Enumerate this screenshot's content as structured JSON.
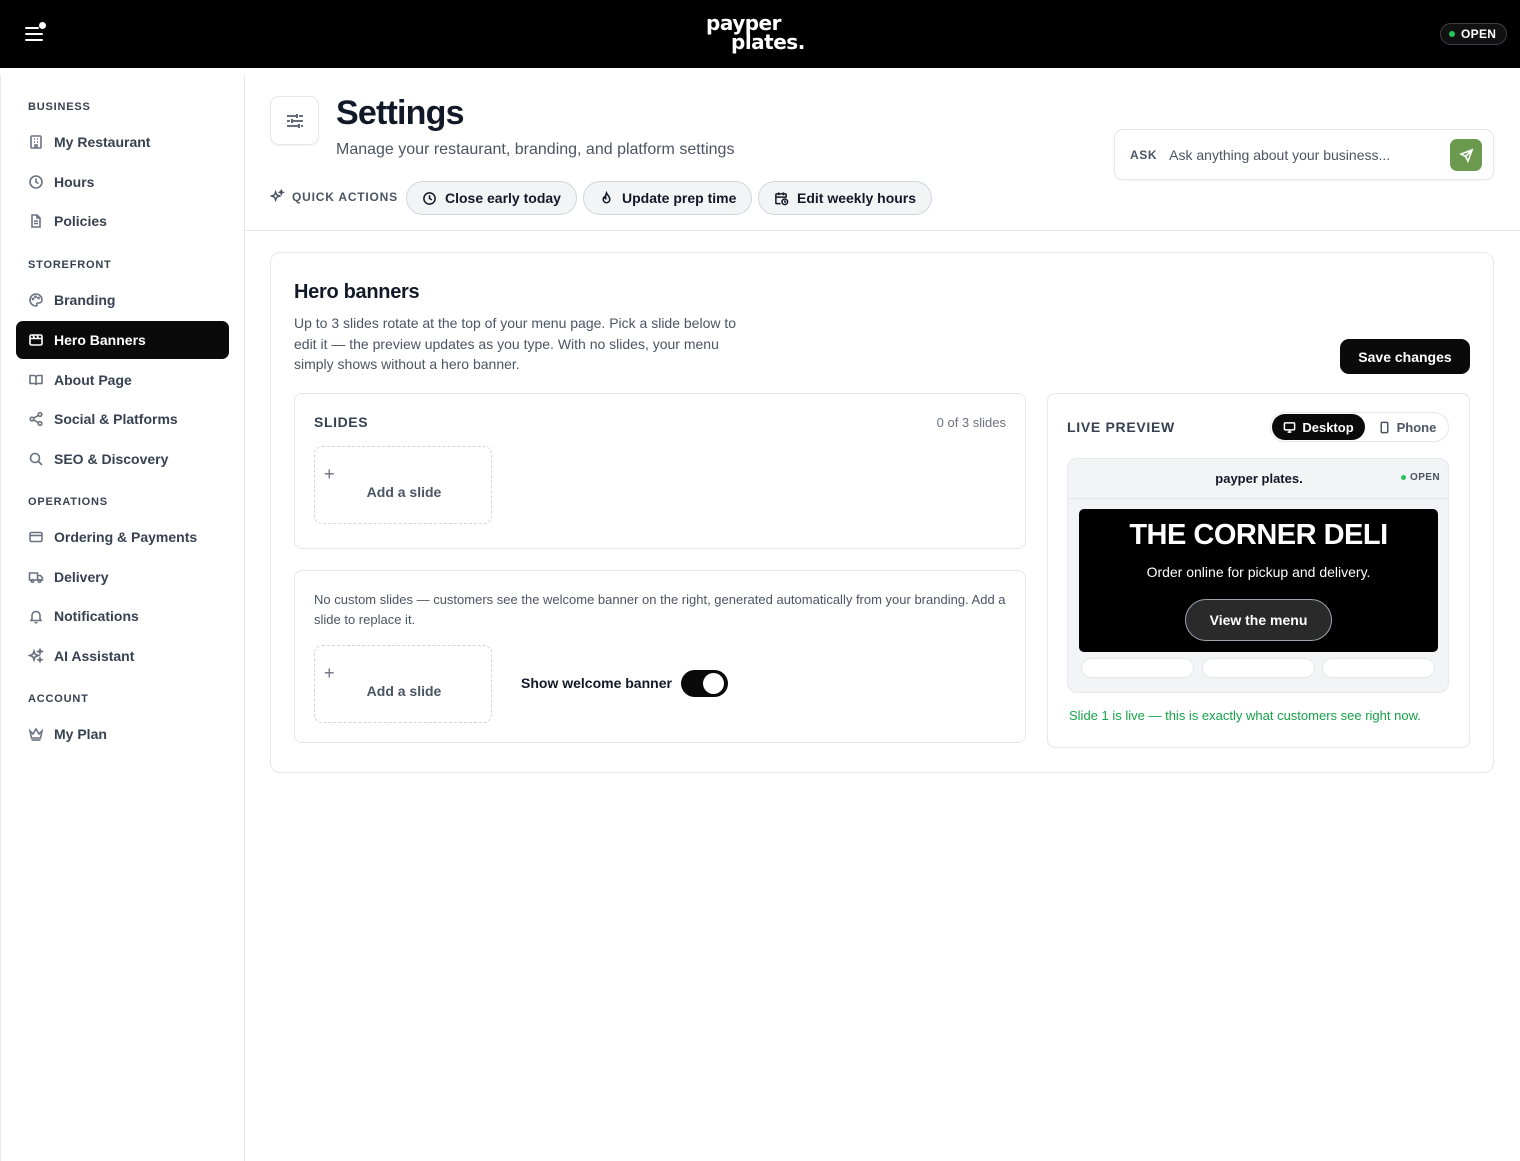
{
  "topbar": {
    "logo_line1": "payper",
    "logo_line2": "plates.",
    "status": "OPEN"
  },
  "sidebar": {
    "sections": [
      {
        "label": "BUSINESS",
        "items": [
          {
            "label": "My Restaurant",
            "icon": "building-icon"
          },
          {
            "label": "Hours",
            "icon": "clock-icon"
          },
          {
            "label": "Policies",
            "icon": "document-icon"
          }
        ]
      },
      {
        "label": "STOREFRONT",
        "items": [
          {
            "label": "Branding",
            "icon": "palette-icon"
          },
          {
            "label": "Hero Banners",
            "icon": "image-frame-icon",
            "active": true
          },
          {
            "label": "About Page",
            "icon": "book-icon"
          },
          {
            "label": "Social & Platforms",
            "icon": "share-icon"
          },
          {
            "label": "SEO & Discovery",
            "icon": "search-icon"
          }
        ]
      },
      {
        "label": "OPERATIONS",
        "items": [
          {
            "label": "Ordering & Payments",
            "icon": "credit-card-icon"
          },
          {
            "label": "Delivery",
            "icon": "truck-icon"
          },
          {
            "label": "Notifications",
            "icon": "bell-icon"
          },
          {
            "label": "AI Assistant",
            "icon": "sparkles-icon"
          }
        ]
      },
      {
        "label": "ACCOUNT",
        "items": [
          {
            "label": "My Plan",
            "icon": "crown-icon"
          }
        ]
      }
    ]
  },
  "header": {
    "title": "Settings",
    "subtitle": "Manage your restaurant, branding, and platform settings",
    "quick_actions_label": "QUICK ACTIONS",
    "quick_actions": [
      {
        "label": "Close early today",
        "icon": "clock-icon"
      },
      {
        "label": "Update prep time",
        "icon": "flame-icon"
      },
      {
        "label": "Edit weekly hours",
        "icon": "calendar-clock-icon"
      }
    ],
    "ask": {
      "label": "ASK",
      "placeholder": "Ask anything about your business..."
    }
  },
  "hero_banners": {
    "title": "Hero banners",
    "description": "Up to 3 slides rotate at the top of your menu page. Pick a slide below to edit it — the preview updates as you type. With no slides, your menu simply shows without a hero banner.",
    "save_label": "Save changes",
    "slides": {
      "title": "SLIDES",
      "count": "0 of 3 slides",
      "add_label": "Add a slide",
      "plus": "+"
    },
    "welcome": {
      "text": "No custom slides — customers see the welcome banner on the right, generated automatically from your branding. Add a slide to replace it.",
      "add_label": "Add a slide",
      "plus": "+",
      "toggle_label": "Show welcome banner",
      "toggle_on": true
    },
    "preview": {
      "title": "LIVE PREVIEW",
      "desktop_label": "Desktop",
      "phone_label": "Phone",
      "selected": "Desktop",
      "site_logo": "payper plates.",
      "site_status": "OPEN",
      "hero_title": "THE CORNER DELI",
      "hero_subtitle": "Order online for pickup and delivery.",
      "hero_button": "View the menu",
      "caption": "Slide 1 is live — this is exactly what customers see right now."
    }
  },
  "colors": {
    "accent_send": "#6b9a4f",
    "live_green": "#16a34a",
    "status_dot": "#22c55e",
    "dark": "#0a0a0a"
  }
}
